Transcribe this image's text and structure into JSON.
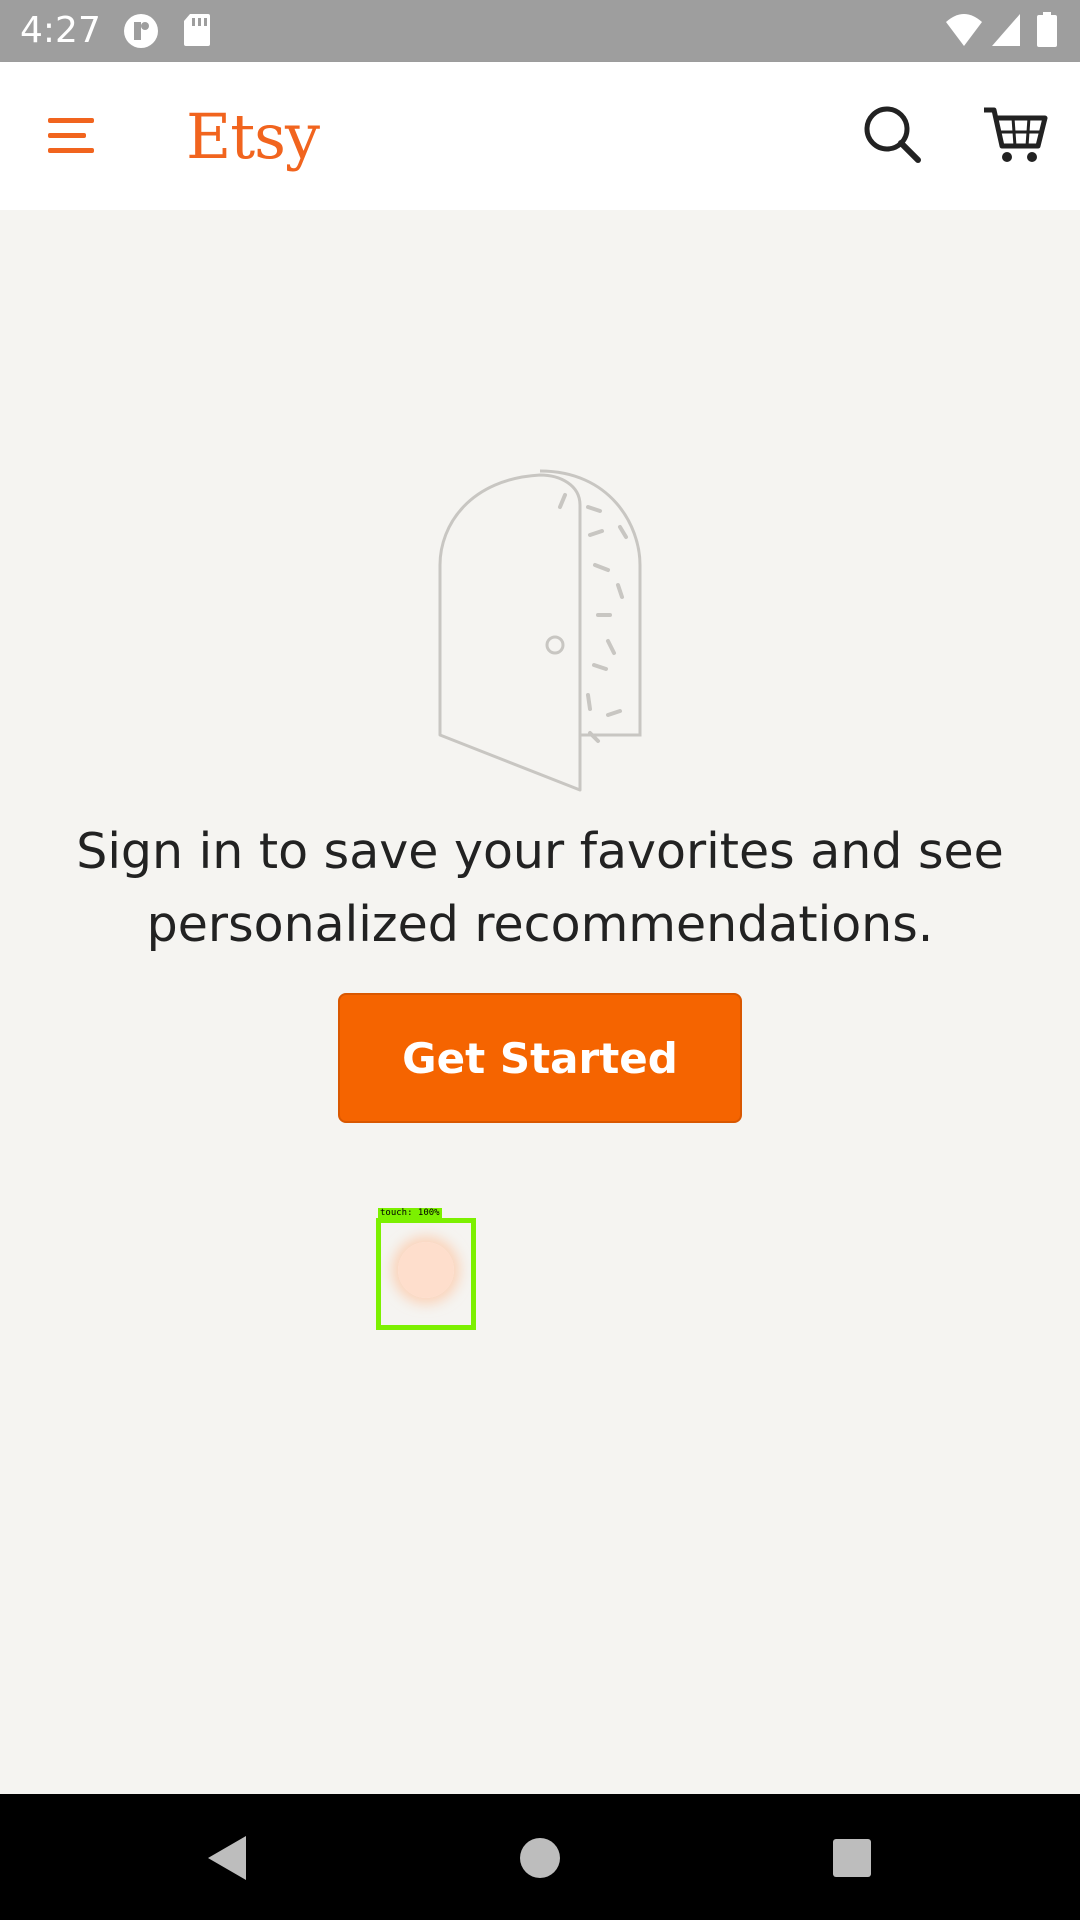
{
  "status_bar": {
    "time": "4:27",
    "icons": [
      "notification-app-icon",
      "sd-card-icon",
      "wifi-icon",
      "signal-icon",
      "battery-icon"
    ]
  },
  "app_bar": {
    "logo_text": "Etsy",
    "menu_icon": "hamburger-menu-icon",
    "search_icon": "search-icon",
    "cart_icon": "shopping-cart-icon",
    "accent_color": "#f1641e"
  },
  "main": {
    "illustration": "door-icon",
    "message": "Sign in to save your favorites and see personalized recommendations.",
    "cta_label": "Get Started",
    "cta_color": "#f56400"
  },
  "touch_overlay": {
    "label": "touch: 100%"
  },
  "nav_bar": {
    "buttons": [
      "back-icon",
      "home-icon",
      "recents-icon"
    ]
  }
}
